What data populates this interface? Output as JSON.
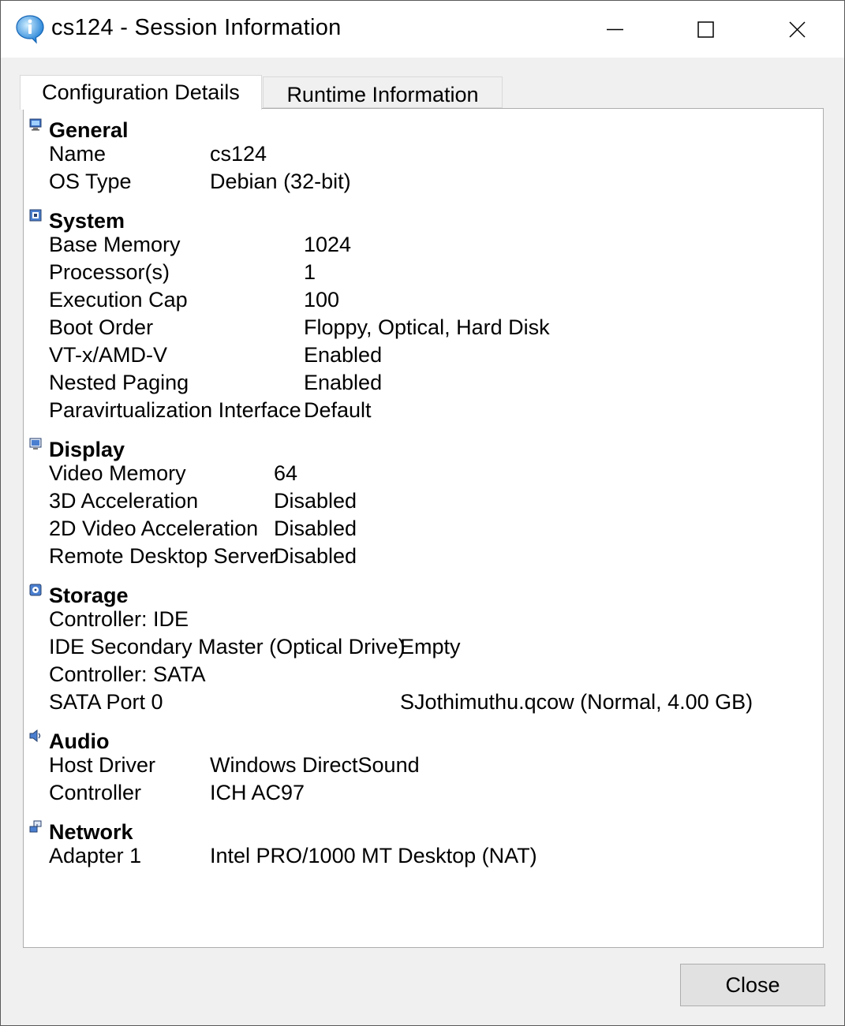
{
  "window": {
    "title": "cs124 - Session Information",
    "icon": "info-balloon-icon"
  },
  "tabs": [
    {
      "label": "Configuration Details",
      "selected": true
    },
    {
      "label": "Runtime Information",
      "selected": false
    }
  ],
  "sections": {
    "general": {
      "title": "General",
      "icon": "general-monitor-icon",
      "rows": [
        {
          "label": "Name",
          "value": "cs124"
        },
        {
          "label": "OS Type",
          "value": "Debian (32-bit)"
        }
      ]
    },
    "system": {
      "title": "System",
      "icon": "chip-icon",
      "rows": [
        {
          "label": "Base Memory",
          "value": "1024"
        },
        {
          "label": "Processor(s)",
          "value": "1"
        },
        {
          "label": "Execution Cap",
          "value": "100"
        },
        {
          "label": "Boot Order",
          "value": "Floppy, Optical, Hard Disk"
        },
        {
          "label": "VT-x/AMD-V",
          "value": "Enabled"
        },
        {
          "label": "Nested Paging",
          "value": "Enabled"
        },
        {
          "label": "Paravirtualization Interface",
          "value": "Default"
        }
      ]
    },
    "display": {
      "title": "Display",
      "icon": "display-icon",
      "rows": [
        {
          "label": "Video Memory",
          "value": "64"
        },
        {
          "label": "3D Acceleration",
          "value": "Disabled"
        },
        {
          "label": "2D Video Acceleration",
          "value": "Disabled"
        },
        {
          "label": "Remote Desktop Server",
          "value": "Disabled"
        }
      ]
    },
    "storage": {
      "title": "Storage",
      "icon": "storage-disk-icon",
      "rows": [
        {
          "label": "Controller: IDE",
          "value": ""
        },
        {
          "label": "IDE Secondary Master (Optical Drive)",
          "value": "Empty"
        },
        {
          "label": "Controller: SATA",
          "value": ""
        },
        {
          "label": "SATA Port 0",
          "value": "SJothimuthu.qcow (Normal, 4.00 GB)"
        }
      ]
    },
    "audio": {
      "title": "Audio",
      "icon": "speaker-icon",
      "rows": [
        {
          "label": "Host Driver",
          "value": "Windows DirectSound"
        },
        {
          "label": "Controller",
          "value": "ICH AC97"
        }
      ]
    },
    "network": {
      "title": "Network",
      "icon": "network-icon",
      "rows": [
        {
          "label": "Adapter 1",
          "value": "Intel PRO/1000 MT Desktop (NAT)"
        }
      ]
    }
  },
  "buttons": {
    "close": "Close"
  }
}
